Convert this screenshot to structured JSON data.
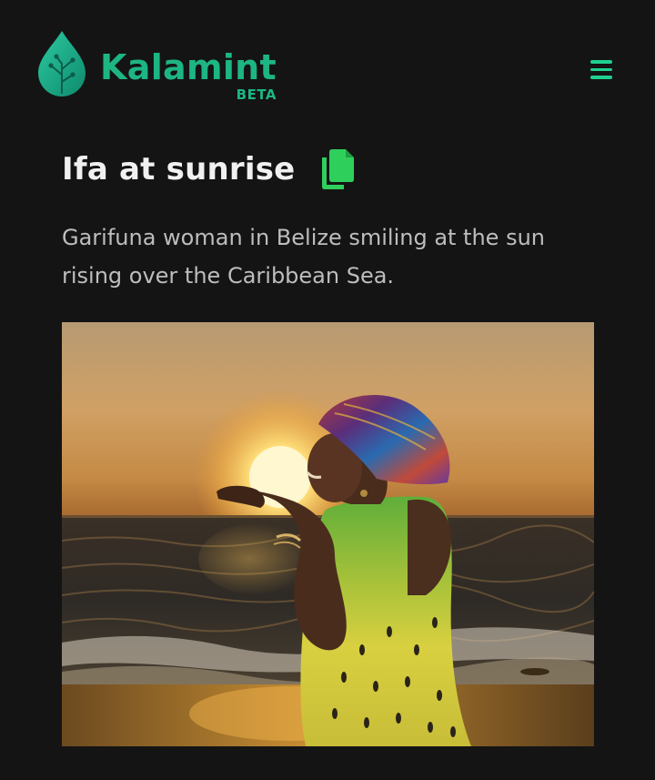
{
  "header": {
    "brand_name": "Kalamint",
    "brand_badge": "BETA",
    "logo_icon": "leaf-circuit-icon",
    "menu_icon": "hamburger-menu-icon",
    "brand_color": "#1db584"
  },
  "nft": {
    "title": "Ifa at sunrise",
    "copy_icon": "copy-icon",
    "copy_icon_color": "#2fcf5c",
    "description": "Garifuna woman in Belize smiling at the sun rising over the Caribbean Sea.",
    "image_subject": "woman-at-sunrise-photo"
  }
}
